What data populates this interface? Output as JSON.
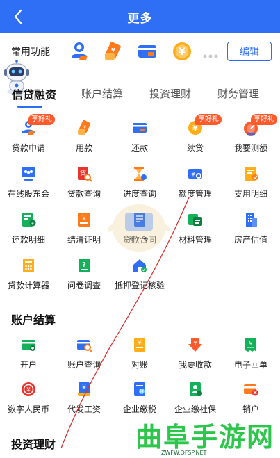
{
  "navbar": {
    "title": "更多",
    "back_icon": "back-chevron-icon"
  },
  "common": {
    "label": "常用功能",
    "edit_label": "编辑",
    "icons": [
      "loan-apply-icon",
      "use-money-icon",
      "repay-card-icon",
      "renew-coin-icon"
    ],
    "more_icon": "more-dots-icon"
  },
  "tabs": [
    {
      "label": "信贷融资",
      "active": true
    },
    {
      "label": "账户结算",
      "active": false
    },
    {
      "label": "投资理财",
      "active": false
    },
    {
      "label": "财务管理",
      "active": false
    }
  ],
  "credit": {
    "items": [
      {
        "label": "贷款申请",
        "badge": "享好礼",
        "icon": "loan-apply-icon"
      },
      {
        "label": "用款",
        "badge": "",
        "icon": "use-money-icon"
      },
      {
        "label": "还款",
        "badge": "",
        "icon": "repay-card-icon"
      },
      {
        "label": "续贷",
        "badge": "享好礼",
        "icon": "renew-coin-icon"
      },
      {
        "label": "我要测额",
        "badge": "享好礼",
        "icon": "gauge-icon"
      },
      {
        "label": "在线股东会",
        "badge": "",
        "icon": "shareholder-meeting-icon"
      },
      {
        "label": "贷款查询",
        "badge": "",
        "icon": "loan-query-icon"
      },
      {
        "label": "进度查询",
        "badge": "",
        "icon": "hourglass-icon"
      },
      {
        "label": "额度管理",
        "badge": "",
        "icon": "quota-card-icon"
      },
      {
        "label": "支用明细",
        "badge": "",
        "icon": "usage-detail-icon"
      },
      {
        "label": "还款明细",
        "badge": "",
        "icon": "repay-detail-icon"
      },
      {
        "label": "结清证明",
        "badge": "",
        "icon": "settlement-cert-icon"
      },
      {
        "label": "贷款合同",
        "badge": "",
        "icon": "contract-icon"
      },
      {
        "label": "材料管理",
        "badge": "",
        "icon": "materials-icon"
      },
      {
        "label": "房产估值",
        "badge": "",
        "icon": "building-icon"
      },
      {
        "label": "贷款计算器",
        "badge": "",
        "icon": "calculator-icon"
      },
      {
        "label": "问卷调查",
        "badge": "",
        "icon": "survey-icon"
      },
      {
        "label": "抵押登记核验",
        "badge": "",
        "icon": "mortgage-verify-icon"
      }
    ]
  },
  "settlement": {
    "title": "账户结算",
    "items": [
      {
        "label": "开户",
        "icon": "open-account-icon"
      },
      {
        "label": "账户查询",
        "icon": "account-query-icon"
      },
      {
        "label": "对账",
        "icon": "reconcile-icon"
      },
      {
        "label": "我要收款",
        "icon": "receive-payment-icon"
      },
      {
        "label": "电子回单",
        "icon": "e-receipt-icon"
      },
      {
        "label": "数字人民币",
        "icon": "digital-rmb-icon"
      },
      {
        "label": "代发工资",
        "icon": "payroll-icon"
      },
      {
        "label": "企业缴税",
        "icon": "tax-icon"
      },
      {
        "label": "企业缴社保",
        "icon": "social-security-icon"
      },
      {
        "label": "销户",
        "icon": "close-account-icon"
      }
    ]
  },
  "investment": {
    "title": "投资理财"
  },
  "watermark": {
    "text": "曲阜手游网",
    "sub": "ZWFW.QFSP.NET"
  },
  "colors": {
    "brand_blue": "#2f6ff6",
    "orange": "#ff7a1a",
    "green": "#14b05a",
    "red": "#e8332e",
    "badge": "#ff5a2c",
    "watermark_green": "#2cc64b"
  }
}
